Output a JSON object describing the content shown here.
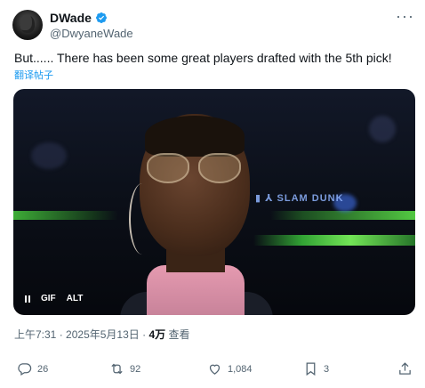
{
  "author": {
    "display_name": "DWade",
    "handle": "@DwyaneWade",
    "verified_icon": "verified-badge-icon",
    "verified_color": "#1d9bf0"
  },
  "tweet": {
    "text": "But...... There has been some great players drafted with the 5th pick!",
    "translate_label": "翻译帖子"
  },
  "media": {
    "type": "GIF",
    "controls": {
      "pause_icon": "pause-icon",
      "gif_label": "GIF",
      "alt_label": "ALT"
    }
  },
  "meta": {
    "time": "上午7:31",
    "separator1": "·",
    "date": "2025年5月13日",
    "separator2": "·",
    "views_count": "4万",
    "views_label": "查看"
  },
  "actions": {
    "reply_count": "26",
    "repost_count": "92",
    "like_count": "1,084",
    "bookmark_count": "3"
  },
  "colors": {
    "text_primary": "#0f1419",
    "text_secondary": "#536471",
    "accent": "#1d9bf0"
  }
}
